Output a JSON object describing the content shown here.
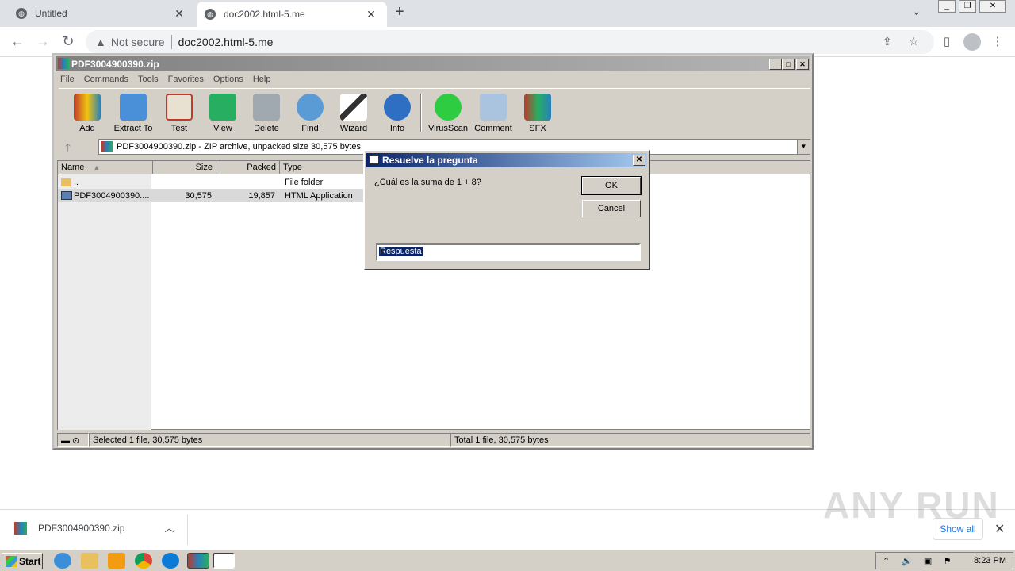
{
  "browser": {
    "tabs": [
      {
        "title": "Untitled"
      },
      {
        "title": "doc2002.html-5.me"
      }
    ],
    "new_tab_symbol": "+",
    "not_secure": "Not secure",
    "url": "doc2002.html-5.me"
  },
  "rar": {
    "title": "PDF3004900390.zip",
    "menu": [
      "File",
      "Commands",
      "Tools",
      "Favorites",
      "Options",
      "Help"
    ],
    "tools": [
      "Add",
      "Extract To",
      "Test",
      "View",
      "Delete",
      "Find",
      "Wizard",
      "Info",
      "VirusScan",
      "Comment",
      "SFX"
    ],
    "address": "PDF3004900390.zip - ZIP archive, unpacked size 30,575 bytes",
    "columns": [
      "Name",
      "Size",
      "Packed",
      "Type"
    ],
    "rows": [
      {
        "name": "..",
        "size": "",
        "packed": "",
        "type": "File folder"
      },
      {
        "name": "PDF3004900390....",
        "size": "30,575",
        "packed": "19,857",
        "type": "HTML Application"
      }
    ],
    "status_left": "Selected 1 file, 30,575 bytes",
    "status_right": "Total 1 file, 30,575 bytes"
  },
  "dialog": {
    "title": "Resuelve la pregunta",
    "question": "¿Cuál es la suma de 1 + 8?",
    "ok": "OK",
    "cancel": "Cancel",
    "answer": "Respuesta"
  },
  "download": {
    "file": "PDF3004900390.zip",
    "show_all": "Show all"
  },
  "watermark": "ANY RUN",
  "taskbar": {
    "start": "Start",
    "clock": "8:23 PM"
  },
  "colors": {
    "dialog_title": "#0a246a",
    "link": "#1a73e8"
  }
}
